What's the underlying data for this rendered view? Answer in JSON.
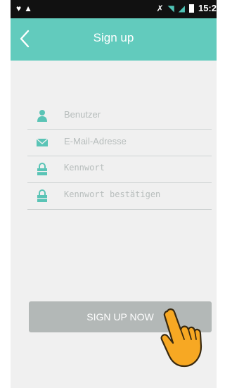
{
  "status_bar": {
    "time": "15:2",
    "left_icons": [
      "heart-icon",
      "warning-icon"
    ],
    "right_icons": [
      "muted-icon",
      "wifi-icon",
      "signal-icon",
      "battery-icon"
    ]
  },
  "app_bar": {
    "title": "Sign up",
    "back_icon": "back-arrow-icon"
  },
  "form": {
    "fields": [
      {
        "placeholder": "Benutzer",
        "icon": "user-icon",
        "value": ""
      },
      {
        "placeholder": "E-Mail-Adresse",
        "icon": "mail-icon",
        "value": ""
      },
      {
        "placeholder": "Kennwort",
        "icon": "lock-icon",
        "value": ""
      },
      {
        "placeholder": "Kennwort bestätigen",
        "icon": "lock-icon",
        "value": ""
      }
    ],
    "submit_label": "SIGN UP NOW"
  },
  "colors": {
    "accent": "#62cbbd",
    "button": "#b3b8b7",
    "background": "#f0f0f0",
    "hand": "#f7a823"
  }
}
